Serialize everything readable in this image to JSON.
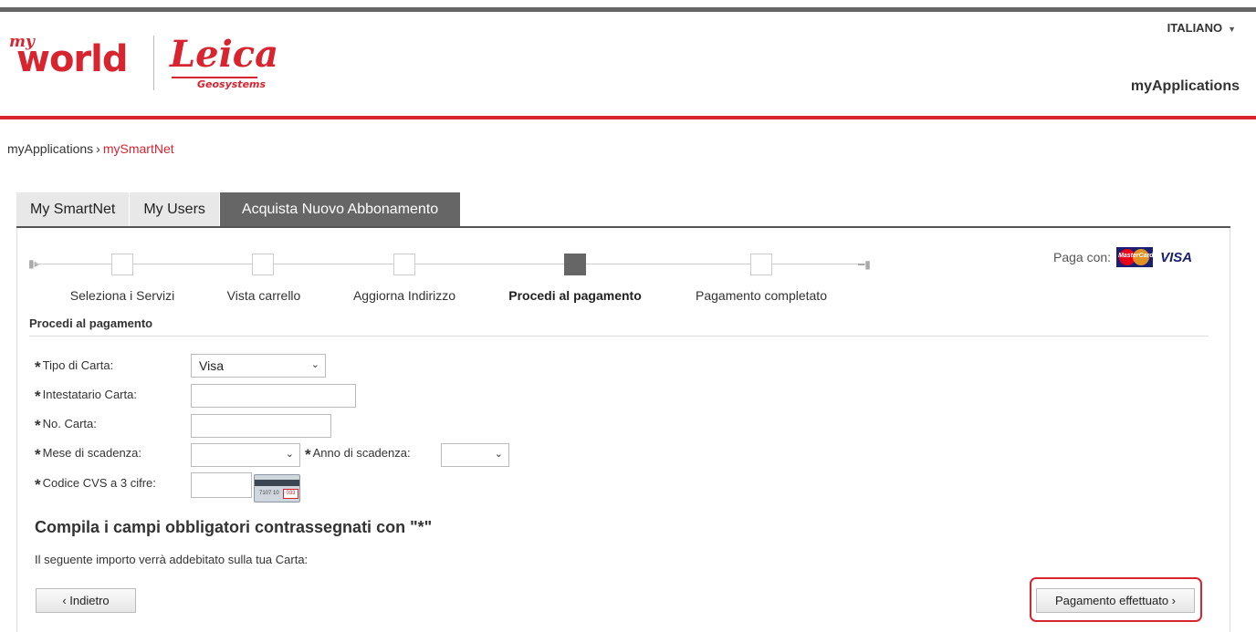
{
  "header": {
    "logo_my": "my",
    "logo_world": "world",
    "logo_leica": "Leica",
    "logo_geosystems": "Geosystems",
    "language": "ITALIANO",
    "my_applications": "myApplications"
  },
  "breadcrumb": {
    "parent": "myApplications",
    "separator": "›",
    "current": "mySmartNet"
  },
  "tabs": [
    {
      "label": "My SmartNet"
    },
    {
      "label": "My Users"
    },
    {
      "label": "Acquista Nuovo Abbonamento"
    }
  ],
  "steps": [
    {
      "label": "Seleziona i Servizi",
      "active": false
    },
    {
      "label": "Vista carrello",
      "active": false
    },
    {
      "label": "Aggiorna Indirizzo",
      "active": false
    },
    {
      "label": "Procedi al pagamento",
      "active": true
    },
    {
      "label": "Pagamento completato",
      "active": false
    }
  ],
  "payment_logos": {
    "label": "Paga con:",
    "mastercard": "MasterCard",
    "visa": "VISA"
  },
  "form": {
    "section_title": "Procedi al pagamento",
    "required_mark": "*",
    "card_type_label": "Tipo di Carta:",
    "card_type_value": "Visa",
    "holder_label": "Intestatario Carta:",
    "holder_value": "",
    "number_label": "No. Carta:",
    "number_value": "",
    "exp_month_label": "Mese di scadenza:",
    "exp_month_value": "",
    "exp_year_label": "Anno di scadenza:",
    "exp_year_value": "",
    "cvs_label": "Codice CVS a 3 cifre:",
    "cvs_value": "",
    "card_icon_number": "7107 10",
    "card_icon_cvv": "033",
    "required_note": "Compila i campi obbligatori contrassegnati con \"*\"",
    "charge_note": "Il seguente importo verrà addebitato sulla tua Carta:"
  },
  "buttons": {
    "back": "‹ Indietro",
    "pay": "Pagamento effettuato ›"
  }
}
